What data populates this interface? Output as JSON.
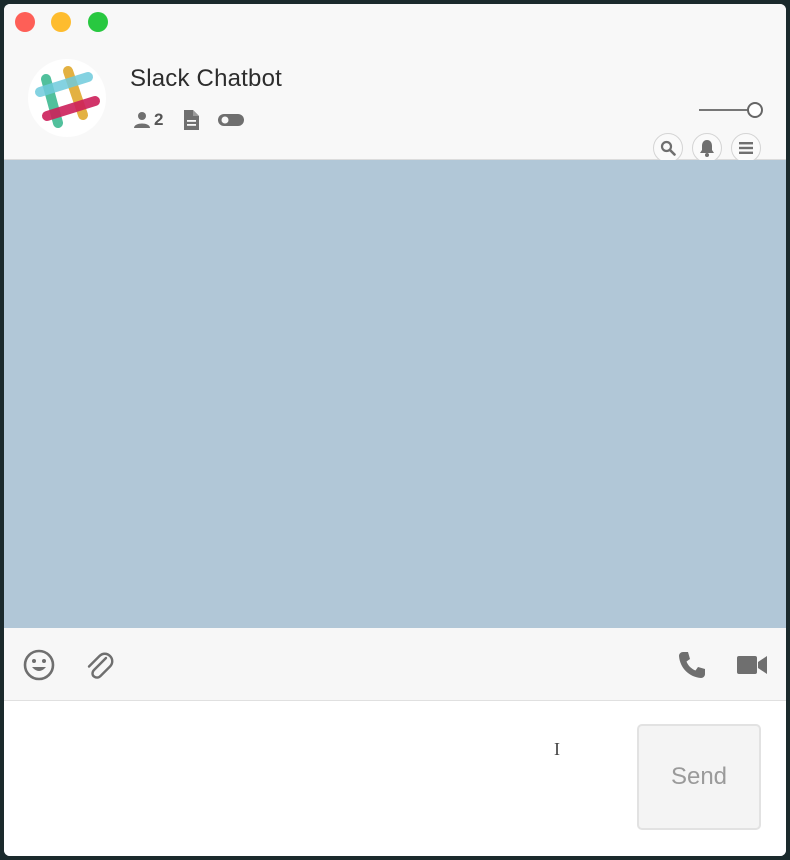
{
  "window": {
    "traffic_lights": [
      "close",
      "minimize",
      "maximize"
    ]
  },
  "header": {
    "title": "Slack Chatbot",
    "avatar_icon": "slack-logo",
    "members_count": "2",
    "meta_icons": [
      "user-icon",
      "document-icon",
      "toggle-icon"
    ],
    "action_icons": [
      "search-icon",
      "bell-icon",
      "menu-icon"
    ]
  },
  "toolbar": {
    "left_icons": [
      "emoji-icon",
      "paperclip-icon"
    ],
    "right_icons": [
      "phone-icon",
      "video-camera-icon"
    ]
  },
  "composer": {
    "input_value": "",
    "input_placeholder": "",
    "send_label": "Send"
  },
  "colors": {
    "messages_background": "#b1c7d7",
    "header_background": "#f8f8f8",
    "icon_gray": "#6f6f6f"
  }
}
